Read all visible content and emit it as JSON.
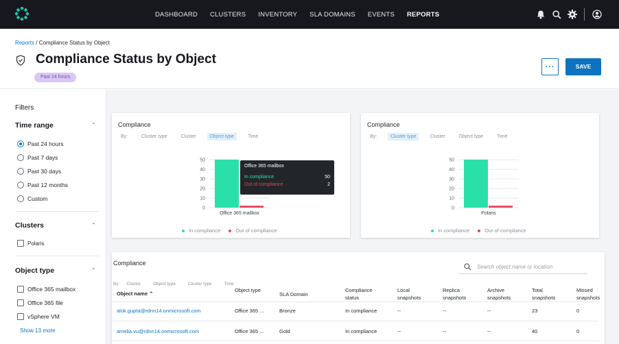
{
  "nav": {
    "links": [
      "DASHBOARD",
      "CLUSTERS",
      "INVENTORY",
      "SLA DOMAINS",
      "EVENTS",
      "REPORTS"
    ],
    "active": "REPORTS"
  },
  "header": {
    "breadcrumb_root": "Reports",
    "breadcrumb_sep": " / ",
    "breadcrumb_current": "Compliance Status by Object",
    "title": "Compliance Status by Object",
    "tag": "Past 24 hours",
    "more_label": "···",
    "save_label": "SAVE"
  },
  "filters": {
    "heading": "Filters",
    "time_range": {
      "label": "Time range",
      "options": [
        "Past 24 hours",
        "Past 7 days",
        "Past 30 days",
        "Past 12 months",
        "Custom"
      ],
      "selected": "Past 24 hours"
    },
    "clusters": {
      "label": "Clusters",
      "options": [
        "Polaris"
      ]
    },
    "object_type": {
      "label": "Object type",
      "options": [
        "Office 365 mailbox",
        "Office 365 file",
        "vSphere VM"
      ],
      "show_more": "Show 13 more"
    }
  },
  "charts": {
    "by_label": "By:",
    "group_options": [
      "Cluster type",
      "Cluster",
      "Object type",
      "Time"
    ],
    "legend": [
      "In compliance",
      "Out of compliance"
    ],
    "colors": {
      "in": "#2be0a8",
      "out": "#e8435a"
    },
    "tooltip": {
      "title": "Office 365 mailbox",
      "in_label": "In compliance",
      "in_value": "50",
      "out_label": "Out of compliance",
      "out_value": "2"
    }
  },
  "chart_data": [
    {
      "type": "bar",
      "title": "Compliance",
      "group_by": "Object type",
      "categories": [
        "Office 365 mailbox"
      ],
      "series": [
        {
          "name": "In compliance",
          "values": [
            50
          ]
        },
        {
          "name": "Out of compliance",
          "values": [
            2
          ]
        }
      ],
      "yticks": [
        0,
        10,
        20,
        30,
        40,
        50
      ],
      "ylim": [
        0,
        50
      ],
      "grid": true,
      "legend": "bottom"
    },
    {
      "type": "bar",
      "title": "Compliance",
      "group_by": "Cluster type",
      "categories": [
        "Polaris"
      ],
      "series": [
        {
          "name": "In compliance",
          "values": [
            50
          ]
        },
        {
          "name": "Out of compliance",
          "values": [
            2
          ]
        }
      ],
      "yticks": [
        0,
        10,
        20,
        30,
        40,
        50
      ],
      "ylim": [
        0,
        50
      ],
      "grid": true,
      "legend": "bottom"
    }
  ],
  "table": {
    "title": "Compliance",
    "search_placeholder": "Search object name or location",
    "by_label": "By:",
    "group_options": [
      "Cluster",
      "Object type",
      "Cluster type",
      "Time"
    ],
    "columns": [
      "Object name ⌃",
      "Object type",
      "SLA Domain",
      "Compliance status",
      "Local snapshots",
      "Replica snapshots",
      "Archive snapshots",
      "Total snapshots",
      "Missed snapshots"
    ],
    "rows": [
      [
        "alok.gupta@rdnn14.onmicrosoft.com",
        "Office 365 ...",
        "Bronze",
        "In compliance",
        "--",
        "--",
        "--",
        "23",
        "0"
      ],
      [
        "amelia.vu@rdnn14.onmicrosoft.com",
        "Office 365 ...",
        "Gold",
        "In compliance",
        "--",
        "--",
        "--",
        "40",
        "0"
      ]
    ]
  }
}
